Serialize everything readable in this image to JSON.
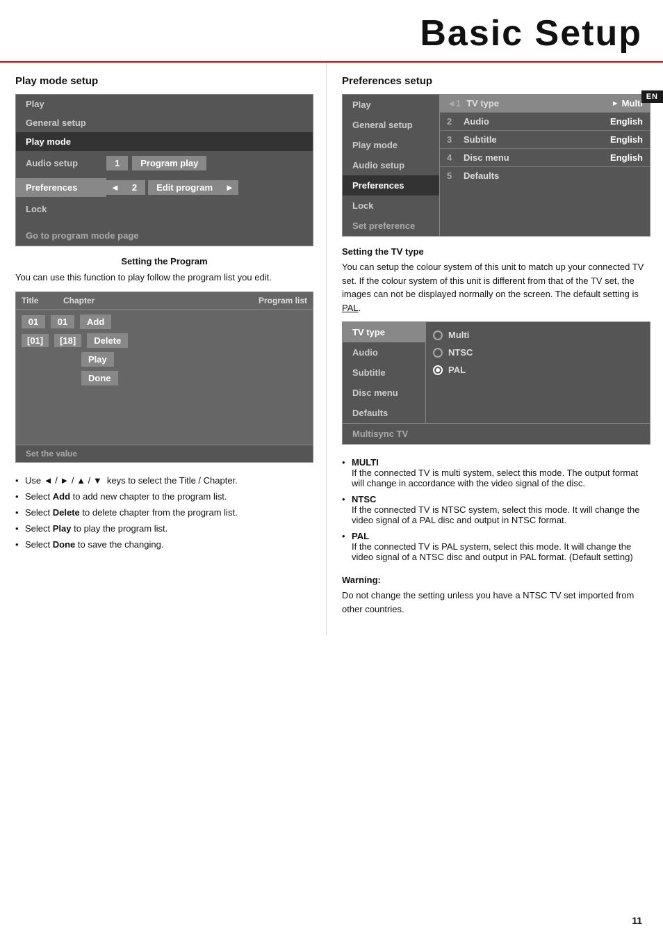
{
  "header": {
    "title": "Basic Setup",
    "en_label": "EN"
  },
  "left_section": {
    "title": "Play mode setup",
    "menu_items": [
      {
        "label": "Play",
        "state": "normal"
      },
      {
        "label": "General setup",
        "state": "normal"
      },
      {
        "label": "Play mode",
        "state": "active"
      },
      {
        "label": "Audio setup",
        "state": "normal"
      },
      {
        "label": "Preferences",
        "state": "highlighted"
      },
      {
        "label": "Lock",
        "state": "normal"
      }
    ],
    "goto_label": "Go to program mode page",
    "option1_label": "1",
    "option1_value": "Program play",
    "option2_label": "◄ 2",
    "option2_value": "Edit program",
    "option2_arrow": "►",
    "setting_program_heading": "Setting the Program",
    "setting_program_text": "You can use this function to play follow the program list you edit.",
    "program_table": {
      "headers": [
        "Title",
        "Chapter",
        "",
        "Program list"
      ],
      "rows": [
        {
          "title": "01",
          "chapter": "01",
          "action": "Add"
        },
        {
          "title": "[01]",
          "chapter": "[18]",
          "action": "Delete"
        },
        {
          "action2": "Play"
        },
        {
          "action2": "Done"
        }
      ]
    },
    "set_value_label": "Set the value",
    "bullets": [
      "Use ◄ / ► / ▲ / ▼  keys to select the Title / Chapter.",
      "Select Add to add new chapter to the program list.",
      "Select Delete to delete chapter from the program list.",
      "Select Play to play the program list.",
      "Select Done to save the changing."
    ]
  },
  "right_section": {
    "title": "Preferences setup",
    "pref_menu_left": [
      {
        "label": "Play",
        "state": "normal"
      },
      {
        "label": "General setup",
        "state": "normal"
      },
      {
        "label": "Play mode",
        "state": "normal"
      },
      {
        "label": "Audio setup",
        "state": "normal"
      },
      {
        "label": "Preferences",
        "state": "active"
      },
      {
        "label": "Lock",
        "state": "normal"
      },
      {
        "label": "Set preference",
        "state": "normal"
      }
    ],
    "pref_options": [
      {
        "num": "◄1",
        "name": "TV type",
        "value": "Multi",
        "arrow_right": "►",
        "highlighted": true
      },
      {
        "num": "2",
        "name": "Audio",
        "value": "English",
        "highlighted": false
      },
      {
        "num": "3",
        "name": "Subtitle",
        "value": "English",
        "highlighted": false
      },
      {
        "num": "4",
        "name": "Disc menu",
        "value": "English",
        "highlighted": false
      },
      {
        "num": "5",
        "name": "Defaults",
        "value": "",
        "highlighted": false
      }
    ],
    "tv_type_heading": "Setting the TV type",
    "tv_type_text": "You can setup the colour system of this unit to match up your connected TV set. If the colour system of this unit is different from that of the TV set, the images can not be displayed normally on the screen. The default setting is PAL.",
    "tv_menu_left_items": [
      {
        "label": "TV type",
        "state": "highlighted"
      },
      {
        "label": "Audio",
        "state": "normal"
      },
      {
        "label": "Subtitle",
        "state": "normal"
      },
      {
        "label": "Disc menu",
        "state": "normal"
      },
      {
        "label": "Defaults",
        "state": "normal"
      }
    ],
    "tv_options": [
      {
        "label": "Multi",
        "selected": false
      },
      {
        "label": "NTSC",
        "selected": false
      },
      {
        "label": "PAL",
        "selected": true
      }
    ],
    "tv_bottom": "Multisync TV",
    "bullets": [
      {
        "bold": "MULTI",
        "text": "If the connected TV is multi system, select this mode. The output format will change in accordance with the video signal of the disc."
      },
      {
        "bold": "NTSC",
        "text": "If the connected TV is NTSC system, select this mode. It will change the video signal of a PAL disc and output in NTSC format."
      },
      {
        "bold": "PAL",
        "text": "If the connected TV is PAL system, select this mode. It will change the video signal of a NTSC disc and output in PAL format. (Default setting)"
      }
    ],
    "warning_label": "Warning:",
    "warning_text": "Do not change the setting unless you have a NTSC TV set imported from other countries."
  },
  "page_number": "11"
}
